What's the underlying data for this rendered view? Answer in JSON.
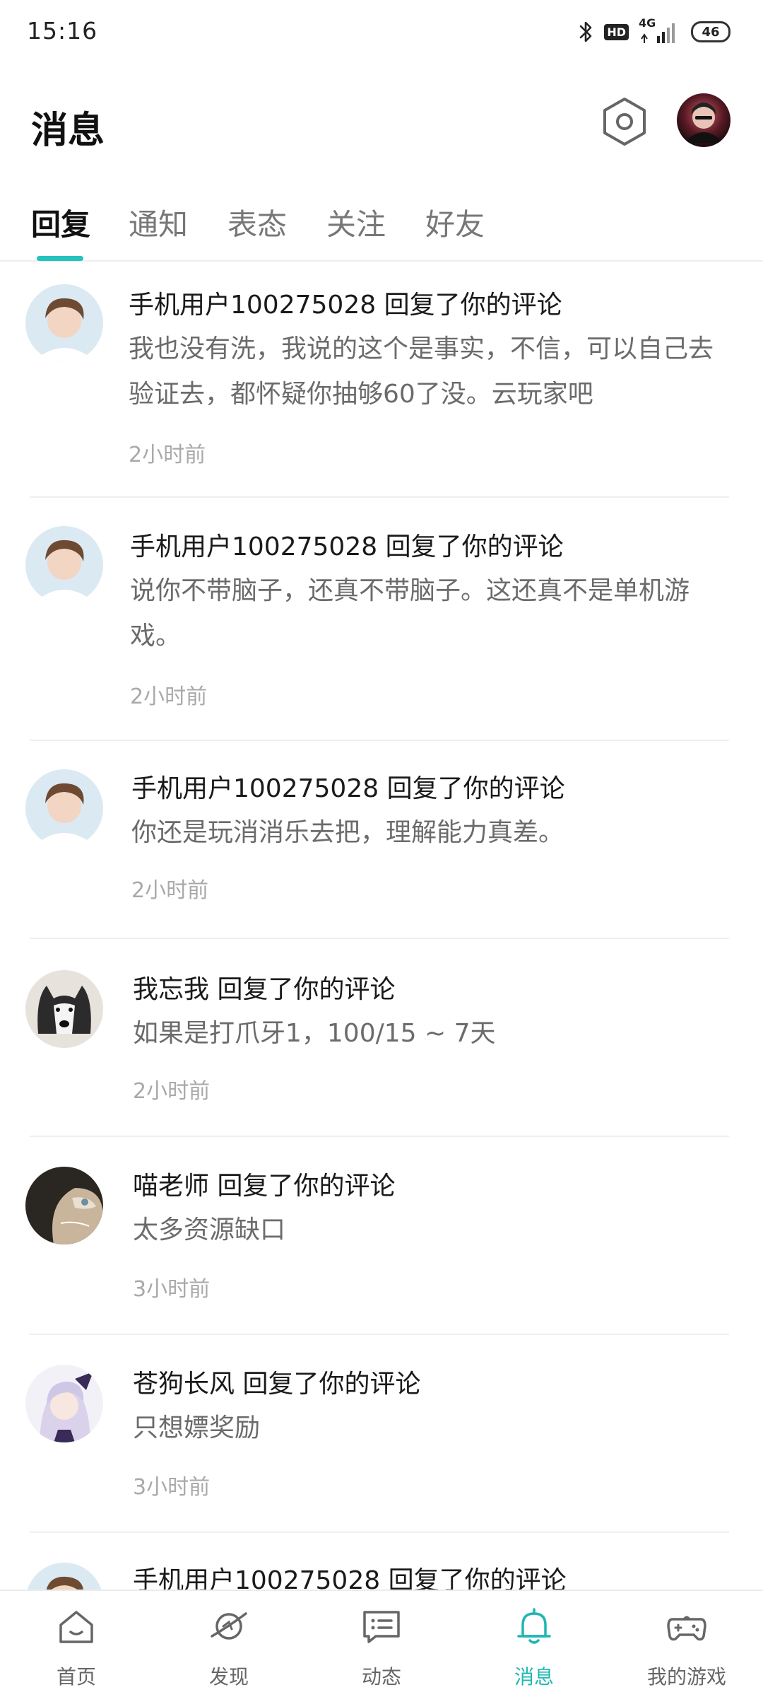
{
  "status_bar": {
    "time": "15:16",
    "hd": "HD",
    "network": "4G",
    "battery": "46"
  },
  "header": {
    "title": "消息"
  },
  "tabs": [
    {
      "label": "回复",
      "active": true
    },
    {
      "label": "通知",
      "active": false
    },
    {
      "label": "表态",
      "active": false
    },
    {
      "label": "关注",
      "active": false
    },
    {
      "label": "好友",
      "active": false
    }
  ],
  "messages": [
    {
      "user": "手机用户100275028",
      "action": "回复了你的评论",
      "body": "我也没有洗，我说的这个是事实，不信，可以自己去验证去，都怀疑你抽够60了没。云玩家吧",
      "time": "2小时前"
    },
    {
      "user": "手机用户100275028",
      "action": "回复了你的评论",
      "body": "说你不带脑子，还真不带脑子。这还真不是单机游戏。",
      "time": "2小时前"
    },
    {
      "user": "手机用户100275028",
      "action": "回复了你的评论",
      "body": "你还是玩消消乐去把，理解能力真差。",
      "time": "2小时前"
    },
    {
      "user": "我忘我",
      "action": "回复了你的评论",
      "body": "如果是打爪牙1，100/15 ~ 7天",
      "time": "2小时前"
    },
    {
      "user": "喵老师",
      "action": "回复了你的评论",
      "body": "太多资源缺口",
      "time": "3小时前"
    },
    {
      "user": "苍狗长风",
      "action": "回复了你的评论",
      "body": "只想嫖奖励",
      "time": "3小时前"
    },
    {
      "user": "手机用户100275028",
      "action": "回复了你的评论",
      "body": "",
      "time": ""
    }
  ],
  "bottom_nav": [
    {
      "label": "首页",
      "icon": "home-icon",
      "active": false
    },
    {
      "label": "发现",
      "icon": "planet-icon",
      "active": false
    },
    {
      "label": "动态",
      "icon": "chat-card-icon",
      "active": false
    },
    {
      "label": "消息",
      "icon": "bell-icon",
      "active": true
    },
    {
      "label": "我的游戏",
      "icon": "gamepad-icon",
      "active": false
    }
  ],
  "colors": {
    "accent": "#25c2be",
    "text_primary": "#1a1a1a",
    "text_secondary": "#6b6b6b",
    "text_muted": "#a9a9a9"
  }
}
